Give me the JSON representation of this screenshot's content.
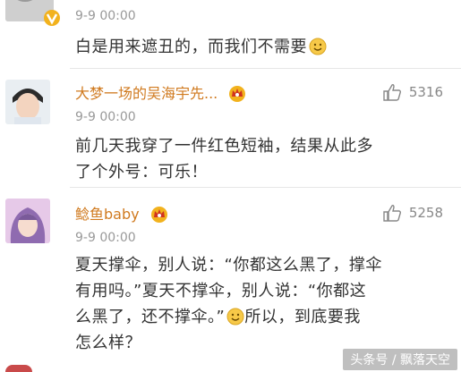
{
  "comments": [
    {
      "time": "9-9 00:00",
      "text": "白是用来遮丑的，而我们不需要",
      "verified": true
    },
    {
      "username": "大梦一场的吴海宇先...",
      "time": "9-9 00:00",
      "likes": "5316",
      "text_lines": [
        "前几天我穿了一件红色短袖，结果从此多",
        "了个外号：可乐！"
      ]
    },
    {
      "username": "鲶鱼baby",
      "time": "9-9 00:00",
      "likes": "5258",
      "text_lines": [
        "夏天撑伞，别人说：“你都这么黑了，撑伞",
        "有用吗。”夏天不撑伞，别人说：“你都这",
        "么黑了，还不撑伞。”",
        "所以，到底要我",
        "怎么样？"
      ]
    }
  ],
  "watermark": {
    "footer": "头条号 / 飘落天空"
  },
  "colors": {
    "username": "#d07a1f",
    "time": "#999999",
    "text": "#333333",
    "like_icon": "#888888"
  },
  "icons": [
    "thumbs-up-icon",
    "smile-emoji-icon",
    "crown-badge-icon",
    "verified-v-icon"
  ]
}
